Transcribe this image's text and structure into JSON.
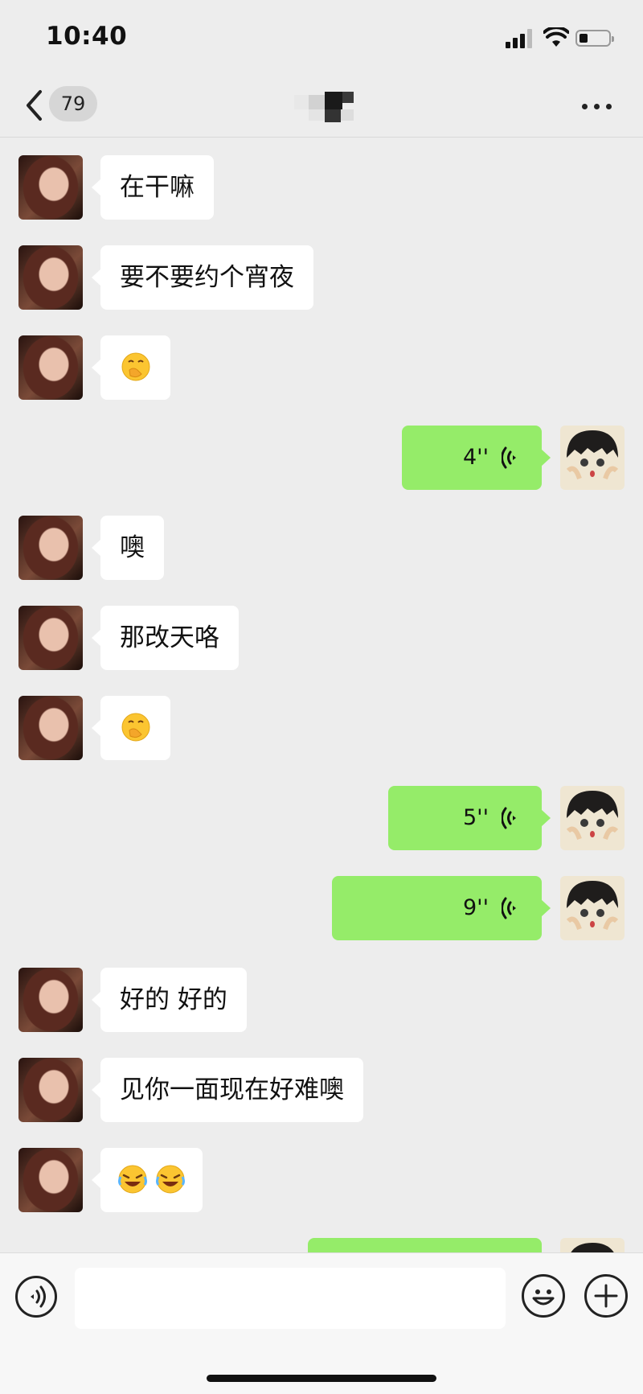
{
  "status_bar": {
    "time": "10:40",
    "icons": [
      "signal-icon",
      "wifi-icon",
      "battery-icon"
    ]
  },
  "nav": {
    "back_icon": "chevron-left-icon",
    "unread_count": "79",
    "more_icon": "more-dots-icon"
  },
  "messages": [
    {
      "side": "in",
      "text": "在干嘛"
    },
    {
      "side": "in",
      "text": "要不要约个宵夜"
    },
    {
      "side": "in",
      "emoji": [
        "thinking-hand-over-mouth-emoji"
      ]
    },
    {
      "side": "out",
      "voice_duration": "4''"
    },
    {
      "side": "in",
      "text": "噢"
    },
    {
      "side": "in",
      "text": "那改天咯"
    },
    {
      "side": "in",
      "emoji": [
        "thinking-hand-over-mouth-emoji"
      ]
    },
    {
      "side": "out",
      "voice_duration": "5''"
    },
    {
      "side": "out",
      "voice_duration": "9''"
    },
    {
      "side": "in",
      "text": "好的 好的"
    },
    {
      "side": "in",
      "text": "见你一面现在好难噢"
    },
    {
      "side": "in",
      "emoji": [
        "rolling-laughing-emoji",
        "rolling-laughing-emoji"
      ]
    },
    {
      "side": "out",
      "voice_duration": ""
    }
  ],
  "input_bar": {
    "voice_icon": "voice-input-icon",
    "emoji_icon": "emoji-icon",
    "plus_icon": "plus-icon",
    "value": ""
  },
  "colors": {
    "background": "#ededed",
    "incoming_bubble": "#ffffff",
    "outgoing_bubble": "#95ec69",
    "input_bar": "#f7f7f7"
  }
}
